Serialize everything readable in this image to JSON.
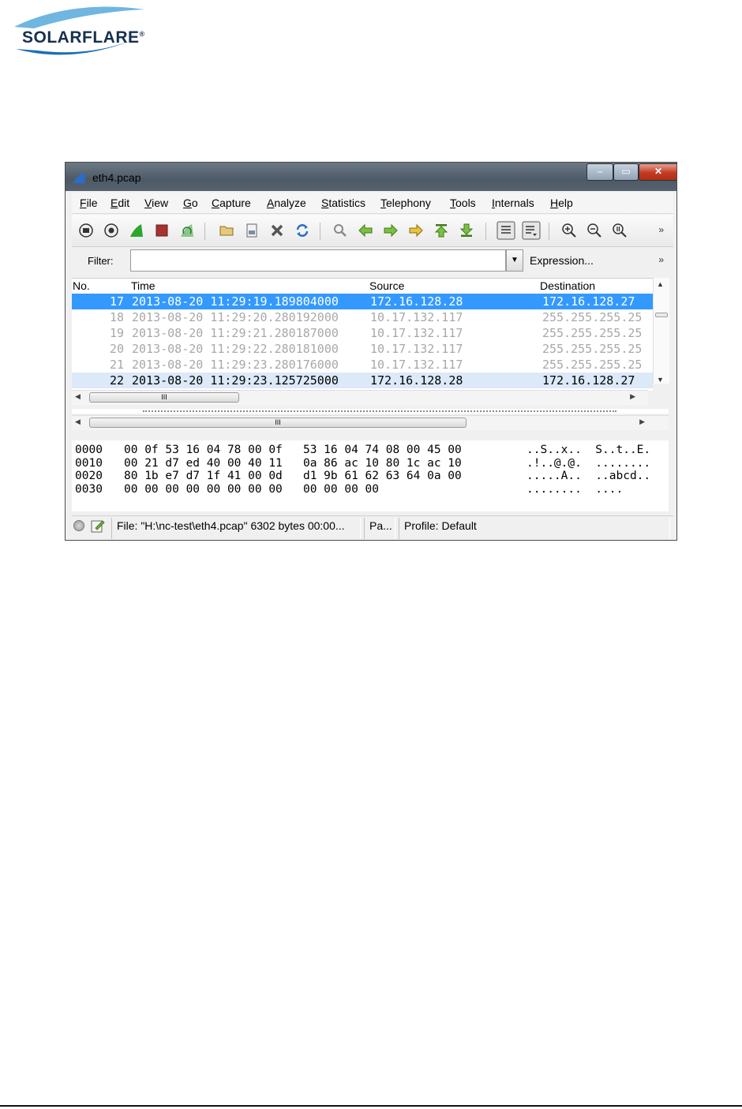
{
  "brand": {
    "name": "SOLARFLARE",
    "mark": "®"
  },
  "window": {
    "title": "eth4.pcap",
    "controls": {
      "minimize": "–",
      "maximize": "▭",
      "close": "✕"
    }
  },
  "menu": [
    "File",
    "Edit",
    "View",
    "Go",
    "Capture",
    "Analyze",
    "Statistics",
    "Telephony",
    "Tools",
    "Internals",
    "Help"
  ],
  "toolbar": {
    "icons": [
      "interfaces-icon",
      "options-icon",
      "start-capture-icon",
      "stop-capture-icon",
      "restart-capture-icon",
      "open-file-icon",
      "save-file-icon",
      "close-file-icon",
      "reload-icon",
      "find-packet-icon",
      "go-back-icon",
      "go-forward-icon",
      "go-to-packet-icon",
      "first-packet-icon",
      "last-packet-icon",
      "colorize-icon",
      "autoscroll-icon",
      "zoom-in-icon",
      "zoom-out-icon",
      "zoom-normal-icon"
    ],
    "more": "»"
  },
  "filter": {
    "label": "Filter:",
    "value": "",
    "expression": "Expression...",
    "more": "»"
  },
  "packet_list": {
    "columns": [
      "No.",
      "Time",
      "Source",
      "Destination"
    ],
    "rows": [
      {
        "no": "17",
        "time": "2013-08-20 11:29:19.189804000",
        "source": "172.16.128.28",
        "destination": "172.16.128.27",
        "style": "selected"
      },
      {
        "no": "18",
        "time": "2013-08-20 11:29:20.280192000",
        "source": "10.17.132.117",
        "destination": "255.255.255.25",
        "style": "grey"
      },
      {
        "no": "19",
        "time": "2013-08-20 11:29:21.280187000",
        "source": "10.17.132.117",
        "destination": "255.255.255.25",
        "style": "grey"
      },
      {
        "no": "20",
        "time": "2013-08-20 11:29:22.280181000",
        "source": "10.17.132.117",
        "destination": "255.255.255.25",
        "style": "grey"
      },
      {
        "no": "21",
        "time": "2013-08-20 11:29:23.280176000",
        "source": "10.17.132.117",
        "destination": "255.255.255.25",
        "style": "grey"
      },
      {
        "no": "22",
        "time": "2013-08-20 11:29:23.125725000",
        "source": "172.16.128.28",
        "destination": "172.16.128.27",
        "style": "light"
      }
    ]
  },
  "scroll": {
    "thumb_grip": "III"
  },
  "hex_dump": [
    {
      "offset": "0000",
      "hex": "00 0f 53 16 04 78 00 0f   53 16 04 74 08 00 45 00",
      "ascii": "..S..x..  S..t..E."
    },
    {
      "offset": "0010",
      "hex": "00 21 d7 ed 40 00 40 11   0a 86 ac 10 80 1c ac 10",
      "ascii": ".!..@.@.  ........"
    },
    {
      "offset": "0020",
      "hex": "80 1b e7 d7 1f 41 00 0d   d1 9b 61 62 63 64 0a 00",
      "ascii": ".....A..  ..abcd.."
    },
    {
      "offset": "0030",
      "hex": "00 00 00 00 00 00 00 00   00 00 00 00",
      "ascii": "........  ...."
    }
  ],
  "status": {
    "file": "File: \"H:\\nc-test\\eth4.pcap\" 6302 bytes 00:00...",
    "packets": "Pa...",
    "profile": "Profile: Default"
  }
}
